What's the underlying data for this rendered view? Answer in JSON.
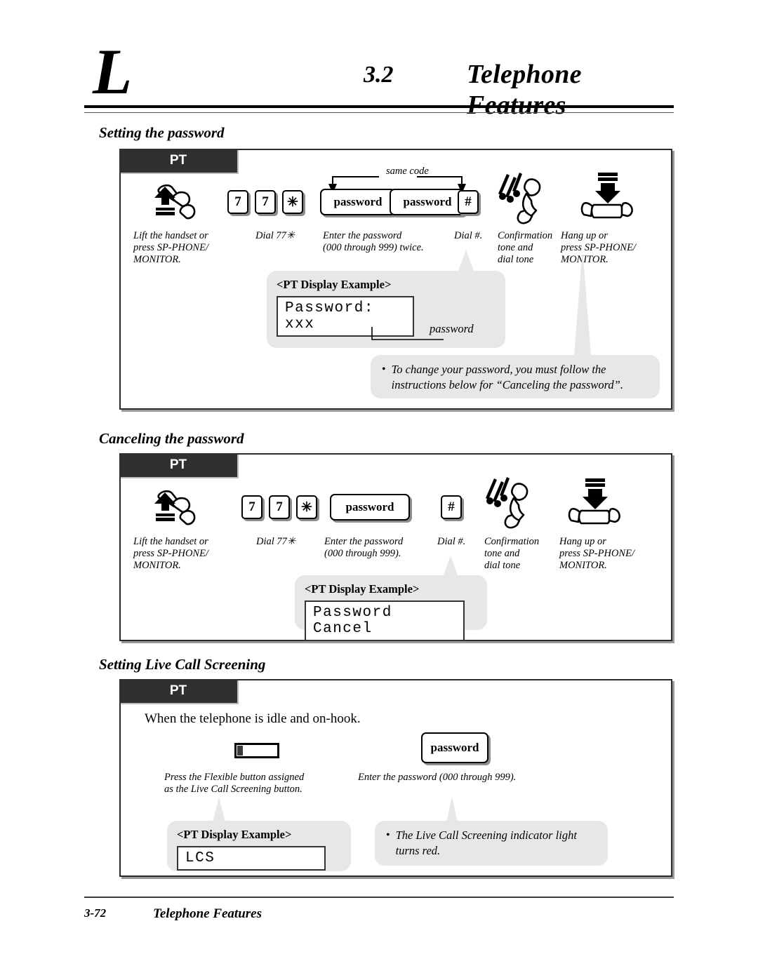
{
  "header": {
    "drop_letter": "L",
    "section_number": "3.2",
    "section_title": "Telephone Features"
  },
  "footer": {
    "page_number": "3-72",
    "title": "Telephone Features"
  },
  "sections": [
    {
      "heading": "Setting the password",
      "pt_label": "PT",
      "same_code_label": "same code",
      "keys": [
        "7",
        "7",
        "✳",
        "password",
        "password",
        "#"
      ],
      "steps": [
        "Lift the handset or\npress SP-PHONE/\nMONITOR.",
        "Dial 77✳",
        "Enter the password\n(000 through 999) twice.",
        "Dial #.",
        "Confirmation\ntone and\ndial tone",
        "Hang up or\npress SP-PHONE/\nMONITOR."
      ],
      "display_callout": {
        "title": "<PT Display Example>",
        "lcd": "Password: xxx",
        "annotation": "password"
      },
      "note_callout": {
        "bullet": "•",
        "line1": "To change your password, you must follow the",
        "line2": "instructions below for “Canceling the password”."
      }
    },
    {
      "heading": "Canceling the password",
      "pt_label": "PT",
      "keys": [
        "7",
        "7",
        "✳",
        "password",
        "#"
      ],
      "steps": [
        "Lift the handset or\npress SP-PHONE/\nMONITOR.",
        "Dial 77✳",
        "Enter the password\n(000 through 999).",
        "Dial #.",
        "Confirmation\ntone and\ndial tone",
        "Hang up or\npress SP-PHONE/\nMONITOR."
      ],
      "display_callout": {
        "title": "<PT Display Example>",
        "lcd": "Password Cancel"
      }
    },
    {
      "heading": "Setting Live Call Screening",
      "pt_label": "PT",
      "intro": "When the telephone is idle and on-hook.",
      "keys": [
        "password"
      ],
      "steps": [
        "Press the Flexible button assigned\nas the Live Call Screening button.",
        "Enter the password (000 through 999)."
      ],
      "display_callout": {
        "title": "<PT Display Example>",
        "lcd": "LCS"
      },
      "note_callout": {
        "bullet": "•",
        "line1": "The Live Call Screening indicator light",
        "line2": "turns red."
      }
    }
  ],
  "icons": {
    "lift_handset": "lift-handset-icon",
    "confirmation_tone": "confirmation-tone-icon",
    "hang_up": "hang-up-icon",
    "flexible_button": "flexible-button-icon"
  },
  "colors": {
    "pt_tab_bg": "#303030",
    "callout_bg": "#e7e7e7",
    "frame_border": "#2b2b2b"
  }
}
